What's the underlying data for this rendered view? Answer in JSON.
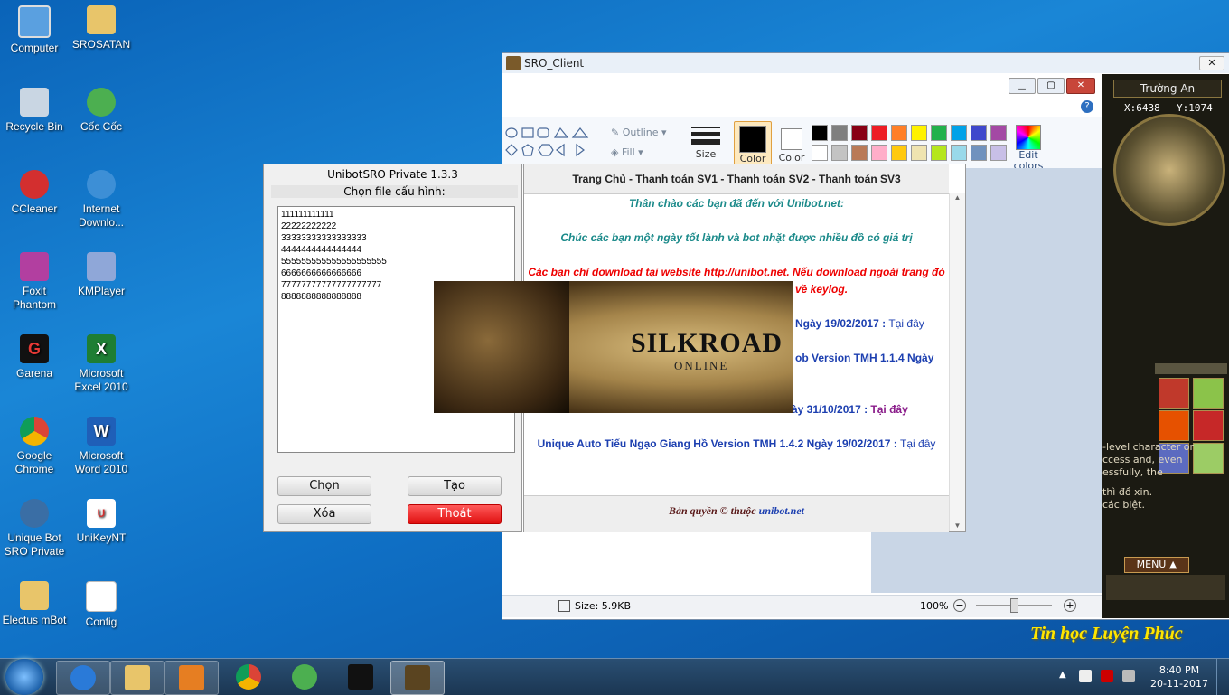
{
  "desktop": {
    "icons": [
      {
        "label": "Computer",
        "icon": "computer-icon"
      },
      {
        "label": "SROSATAN",
        "icon": "folder-icon"
      },
      {
        "label": "Recycle Bin",
        "icon": "recycle-bin-icon"
      },
      {
        "label": "Cốc Cốc",
        "icon": "coccoc-icon"
      },
      {
        "label": "CCleaner",
        "icon": "ccleaner-icon"
      },
      {
        "label": "Internet Downlo...",
        "icon": "idm-icon"
      },
      {
        "label": "Foxit Phantom",
        "icon": "foxit-icon"
      },
      {
        "label": "KMPlayer",
        "icon": "kmplayer-icon"
      },
      {
        "label": "Garena",
        "icon": "garena-icon"
      },
      {
        "label": "Microsoft Excel 2010",
        "icon": "excel-icon"
      },
      {
        "label": "Google Chrome",
        "icon": "chrome-icon"
      },
      {
        "label": "Microsoft Word 2010",
        "icon": "word-icon"
      },
      {
        "label": "Unique Bot SRO Private",
        "icon": "uniquebot-icon"
      },
      {
        "label": "UniKeyNT",
        "icon": "unikey-icon"
      },
      {
        "label": "Electus mBot",
        "icon": "folder-icon"
      },
      {
        "label": "Config",
        "icon": "config-icon"
      }
    ]
  },
  "paint": {
    "title": "SRO_Client",
    "ribbon": {
      "outline": "Outline",
      "fill": "Fill",
      "size": "Size",
      "color1": "Color",
      "color2": "Color",
      "edit_colors": "Edit colors"
    },
    "palette": [
      "#000000",
      "#7f7f7f",
      "#880015",
      "#ed1c24",
      "#ff7f27",
      "#fff200",
      "#22b14c",
      "#00a2e8",
      "#3f48cc",
      "#a349a4",
      "#ffffff",
      "#c3c3c3",
      "#b97a57",
      "#ffaec9",
      "#ffc90e",
      "#efe4b0",
      "#b5e61d",
      "#99d9ea",
      "#7092be",
      "#c8bfe7"
    ],
    "status": {
      "size": "Size: 5.9KB",
      "zoom": "100%"
    }
  },
  "unibot": {
    "title": "UnibotSRO Private 1.3.3",
    "subtitle": "Chọn file cấu hình:",
    "configs": [
      "111111111111",
      "22222222222",
      "33333333333333333",
      "4444444444444444",
      "555555555555555555555",
      "6666666666666666",
      "77777777777777777777",
      "8888888888888888"
    ],
    "buttons": {
      "choose": "Chọn",
      "create": "Tạo",
      "delete": "Xóa",
      "exit": "Thoát"
    }
  },
  "content": {
    "nav": "Trang Chủ - Thanh toán SV1 - Thanh toán SV2 - Thanh toán SV3",
    "welcome": "Thân chào các bạn đã đến với Unibot.net:",
    "wish": "Chúc các bạn một ngày tốt lành và bot nhặt được nhiều đồ có giá trị",
    "warning1": "Các bạn chỉ download tại website http://unibot.net. Nếu download ngoài trang đó",
    "warning2": "về keylog.",
    "item1": "Ngày 19/02/2017 :",
    "item2": "ob Version TMH 1.1.4 Ngày",
    "item3": "ày 31/10/2017 :",
    "item4": "Unique Auto Tiếu Ngạo Giang Hồ Version TMH 1.4.2 Ngày 19/02/2017 :",
    "link": "Tại đây",
    "footer": "Bản quyền © thuộc",
    "footer_link": "unibot.net"
  },
  "splash": {
    "logo": "SILKROAD",
    "sub": "ONLINE"
  },
  "game": {
    "location": "Trường An",
    "x": "X:6438",
    "y": "Y:1074",
    "menu": "MENU",
    "text1": "-level character or",
    "text2": "ccess and, even",
    "text3": "essfully, the",
    "text4": "thì đồ xin.",
    "text5": "các biệt."
  },
  "watermark": "Tin học Luyện Phúc",
  "taskbar": {
    "time": "8:40 PM",
    "date": "20-11-2017"
  }
}
